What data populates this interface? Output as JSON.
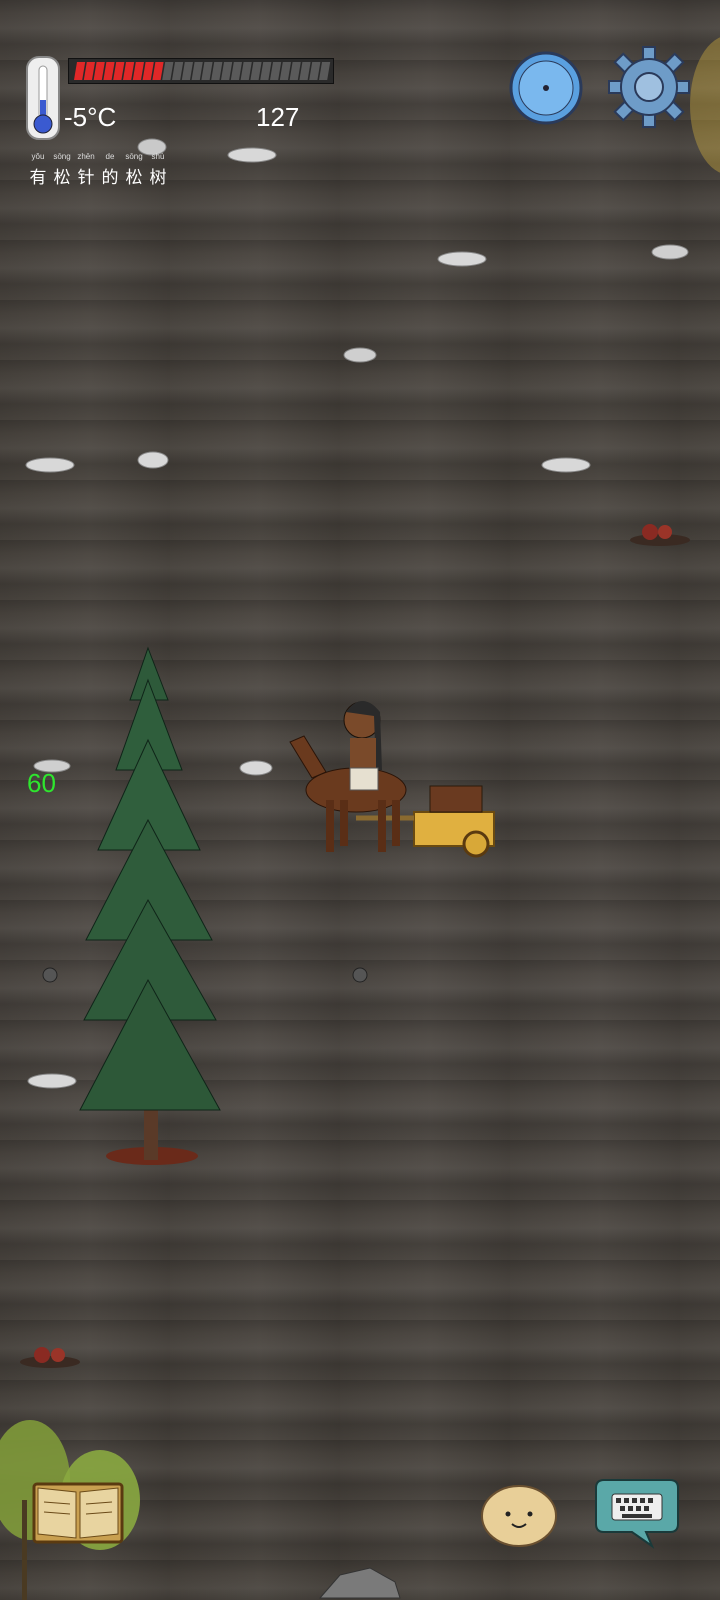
{
  "hud": {
    "temperature": "-5°C",
    "count": "127",
    "health_fraction": 0.34,
    "hint_text": [
      {
        "pinyin": "yǒu",
        "char": "有"
      },
      {
        "pinyin": "sōng",
        "char": "松"
      },
      {
        "pinyin": "zhēn",
        "char": "针"
      },
      {
        "pinyin": "de",
        "char": "的"
      },
      {
        "pinyin": "sōng",
        "char": "松"
      },
      {
        "pinyin": "shù",
        "char": "树"
      }
    ]
  },
  "world": {
    "level_number": "60"
  },
  "icons": {
    "thermometer": "thermometer-icon",
    "compass": "compass-icon",
    "settings": "gear-icon",
    "recipe_book": "book-icon",
    "emote": "face-icon",
    "chat": "keyboard-icon"
  },
  "colors": {
    "health_fill": "#e02828",
    "health_empty": "#5a5a5a",
    "level_text": "#2ee62e",
    "compass_blue": "#5aa0e0",
    "gear_blue": "#6e9cc8"
  }
}
